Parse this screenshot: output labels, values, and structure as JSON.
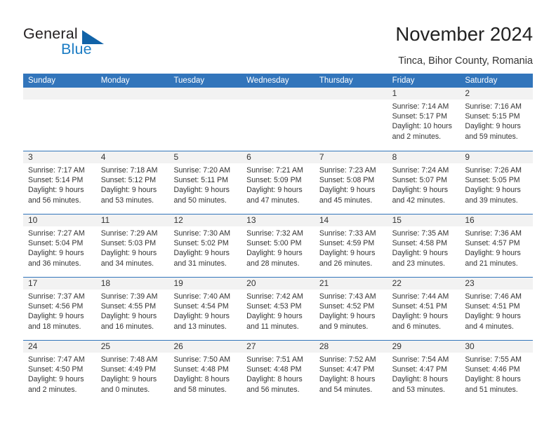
{
  "brand": {
    "name_part1": "General",
    "name_part2": "Blue",
    "triangle_color": "#1163a8",
    "blue_color": "#1b7cc4"
  },
  "header": {
    "title": "November 2024",
    "subtitle": "Tinca, Bihor County, Romania"
  },
  "colors": {
    "header_blue": "#3275bb",
    "band_gray": "#f2f2f2",
    "text": "#333333"
  },
  "weekdays": [
    "Sunday",
    "Monday",
    "Tuesday",
    "Wednesday",
    "Thursday",
    "Friday",
    "Saturday"
  ],
  "labels": {
    "sunrise_prefix": "Sunrise:",
    "sunset_prefix": "Sunset:",
    "daylight_prefix": "Daylight:"
  },
  "weeks": [
    [
      {
        "day": "",
        "empty": true
      },
      {
        "day": "",
        "empty": true
      },
      {
        "day": "",
        "empty": true
      },
      {
        "day": "",
        "empty": true
      },
      {
        "day": "",
        "empty": true
      },
      {
        "day": "1",
        "sunrise": "Sunrise: 7:14 AM",
        "sunset": "Sunset: 5:17 PM",
        "daylight": "Daylight: 10 hours and 2 minutes."
      },
      {
        "day": "2",
        "sunrise": "Sunrise: 7:16 AM",
        "sunset": "Sunset: 5:15 PM",
        "daylight": "Daylight: 9 hours and 59 minutes."
      }
    ],
    [
      {
        "day": "3",
        "sunrise": "Sunrise: 7:17 AM",
        "sunset": "Sunset: 5:14 PM",
        "daylight": "Daylight: 9 hours and 56 minutes."
      },
      {
        "day": "4",
        "sunrise": "Sunrise: 7:18 AM",
        "sunset": "Sunset: 5:12 PM",
        "daylight": "Daylight: 9 hours and 53 minutes."
      },
      {
        "day": "5",
        "sunrise": "Sunrise: 7:20 AM",
        "sunset": "Sunset: 5:11 PM",
        "daylight": "Daylight: 9 hours and 50 minutes."
      },
      {
        "day": "6",
        "sunrise": "Sunrise: 7:21 AM",
        "sunset": "Sunset: 5:09 PM",
        "daylight": "Daylight: 9 hours and 47 minutes."
      },
      {
        "day": "7",
        "sunrise": "Sunrise: 7:23 AM",
        "sunset": "Sunset: 5:08 PM",
        "daylight": "Daylight: 9 hours and 45 minutes."
      },
      {
        "day": "8",
        "sunrise": "Sunrise: 7:24 AM",
        "sunset": "Sunset: 5:07 PM",
        "daylight": "Daylight: 9 hours and 42 minutes."
      },
      {
        "day": "9",
        "sunrise": "Sunrise: 7:26 AM",
        "sunset": "Sunset: 5:05 PM",
        "daylight": "Daylight: 9 hours and 39 minutes."
      }
    ],
    [
      {
        "day": "10",
        "sunrise": "Sunrise: 7:27 AM",
        "sunset": "Sunset: 5:04 PM",
        "daylight": "Daylight: 9 hours and 36 minutes."
      },
      {
        "day": "11",
        "sunrise": "Sunrise: 7:29 AM",
        "sunset": "Sunset: 5:03 PM",
        "daylight": "Daylight: 9 hours and 34 minutes."
      },
      {
        "day": "12",
        "sunrise": "Sunrise: 7:30 AM",
        "sunset": "Sunset: 5:02 PM",
        "daylight": "Daylight: 9 hours and 31 minutes."
      },
      {
        "day": "13",
        "sunrise": "Sunrise: 7:32 AM",
        "sunset": "Sunset: 5:00 PM",
        "daylight": "Daylight: 9 hours and 28 minutes."
      },
      {
        "day": "14",
        "sunrise": "Sunrise: 7:33 AM",
        "sunset": "Sunset: 4:59 PM",
        "daylight": "Daylight: 9 hours and 26 minutes."
      },
      {
        "day": "15",
        "sunrise": "Sunrise: 7:35 AM",
        "sunset": "Sunset: 4:58 PM",
        "daylight": "Daylight: 9 hours and 23 minutes."
      },
      {
        "day": "16",
        "sunrise": "Sunrise: 7:36 AM",
        "sunset": "Sunset: 4:57 PM",
        "daylight": "Daylight: 9 hours and 21 minutes."
      }
    ],
    [
      {
        "day": "17",
        "sunrise": "Sunrise: 7:37 AM",
        "sunset": "Sunset: 4:56 PM",
        "daylight": "Daylight: 9 hours and 18 minutes."
      },
      {
        "day": "18",
        "sunrise": "Sunrise: 7:39 AM",
        "sunset": "Sunset: 4:55 PM",
        "daylight": "Daylight: 9 hours and 16 minutes."
      },
      {
        "day": "19",
        "sunrise": "Sunrise: 7:40 AM",
        "sunset": "Sunset: 4:54 PM",
        "daylight": "Daylight: 9 hours and 13 minutes."
      },
      {
        "day": "20",
        "sunrise": "Sunrise: 7:42 AM",
        "sunset": "Sunset: 4:53 PM",
        "daylight": "Daylight: 9 hours and 11 minutes."
      },
      {
        "day": "21",
        "sunrise": "Sunrise: 7:43 AM",
        "sunset": "Sunset: 4:52 PM",
        "daylight": "Daylight: 9 hours and 9 minutes."
      },
      {
        "day": "22",
        "sunrise": "Sunrise: 7:44 AM",
        "sunset": "Sunset: 4:51 PM",
        "daylight": "Daylight: 9 hours and 6 minutes."
      },
      {
        "day": "23",
        "sunrise": "Sunrise: 7:46 AM",
        "sunset": "Sunset: 4:51 PM",
        "daylight": "Daylight: 9 hours and 4 minutes."
      }
    ],
    [
      {
        "day": "24",
        "sunrise": "Sunrise: 7:47 AM",
        "sunset": "Sunset: 4:50 PM",
        "daylight": "Daylight: 9 hours and 2 minutes."
      },
      {
        "day": "25",
        "sunrise": "Sunrise: 7:48 AM",
        "sunset": "Sunset: 4:49 PM",
        "daylight": "Daylight: 9 hours and 0 minutes."
      },
      {
        "day": "26",
        "sunrise": "Sunrise: 7:50 AM",
        "sunset": "Sunset: 4:48 PM",
        "daylight": "Daylight: 8 hours and 58 minutes."
      },
      {
        "day": "27",
        "sunrise": "Sunrise: 7:51 AM",
        "sunset": "Sunset: 4:48 PM",
        "daylight": "Daylight: 8 hours and 56 minutes."
      },
      {
        "day": "28",
        "sunrise": "Sunrise: 7:52 AM",
        "sunset": "Sunset: 4:47 PM",
        "daylight": "Daylight: 8 hours and 54 minutes."
      },
      {
        "day": "29",
        "sunrise": "Sunrise: 7:54 AM",
        "sunset": "Sunset: 4:47 PM",
        "daylight": "Daylight: 8 hours and 53 minutes."
      },
      {
        "day": "30",
        "sunrise": "Sunrise: 7:55 AM",
        "sunset": "Sunset: 4:46 PM",
        "daylight": "Daylight: 8 hours and 51 minutes."
      }
    ]
  ]
}
